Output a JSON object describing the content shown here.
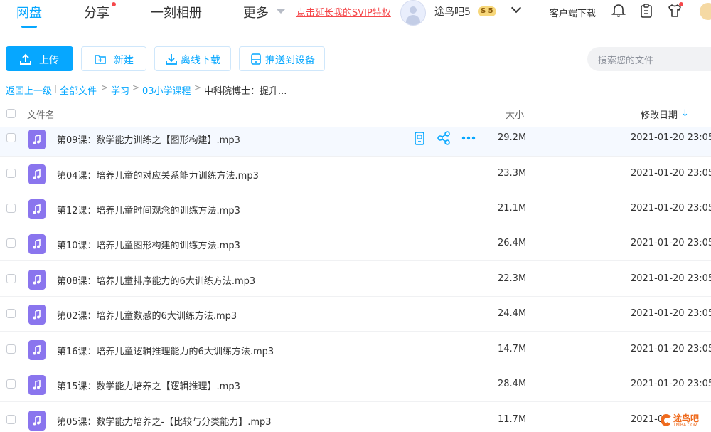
{
  "nav": {
    "netdisk": "网盘",
    "share": "分享",
    "album": "一刻相册",
    "more": "更多",
    "svip_link": "点击延长我的SVIP特权"
  },
  "user": {
    "name": "途鸟吧5",
    "vip_badge": "S 5"
  },
  "top_actions": {
    "client_download": "客户端下载"
  },
  "toolbar": {
    "upload": "上传",
    "new_folder": "新建",
    "offline_download": "离线下载",
    "push_to_device": "推送到设备",
    "search_placeholder": "搜索您的文件"
  },
  "breadcrumb": {
    "back": "返回上一级",
    "all_files": "全部文件",
    "level1": "学习",
    "level2": "03小学课程",
    "current": "中科院博士：提升..."
  },
  "table": {
    "col_name": "文件名",
    "col_size": "大小",
    "col_date": "修改日期",
    "sort_arrow": "↓",
    "rows": [
      {
        "name": "第09课：数学能力训练之【图形构建】.mp3",
        "size": "29.2M",
        "date": "2021-01-20 23:05"
      },
      {
        "name": "第04课：培养儿童的对应关系能力训练方法.mp3",
        "size": "23.3M",
        "date": "2021-01-20 23:05"
      },
      {
        "name": "第12课：培养儿童时间观念的训练方法.mp3",
        "size": "21.1M",
        "date": "2021-01-20 23:05"
      },
      {
        "name": "第10课：培养儿童图形构建的训练方法.mp3",
        "size": "26.4M",
        "date": "2021-01-20 23:05"
      },
      {
        "name": "第08课：培养儿童排序能力的6大训练方法.mp3",
        "size": "22.3M",
        "date": "2021-01-20 23:05"
      },
      {
        "name": "第02课：培养儿童数感的6大训练方法.mp3",
        "size": "24.4M",
        "date": "2021-01-20 23:05"
      },
      {
        "name": "第16课：培养儿童逻辑推理能力的6大训练方法.mp3",
        "size": "14.7M",
        "date": "2021-01-20 23:05"
      },
      {
        "name": "第15课：数学能力培养之【逻辑推理】.mp3",
        "size": "28.4M",
        "date": "2021-01-20 23:05"
      },
      {
        "name": "第05课：数学能力培养之-【比较与分类能力】.mp3",
        "size": "11.7M",
        "date": "2021-0"
      }
    ]
  },
  "watermark": {
    "text": "途鸟吧",
    "sub": "TNIBA.COM"
  },
  "colors": {
    "accent": "#06a7ff",
    "file_icon": "#8a75ee",
    "svip_red": "#f5484b"
  }
}
